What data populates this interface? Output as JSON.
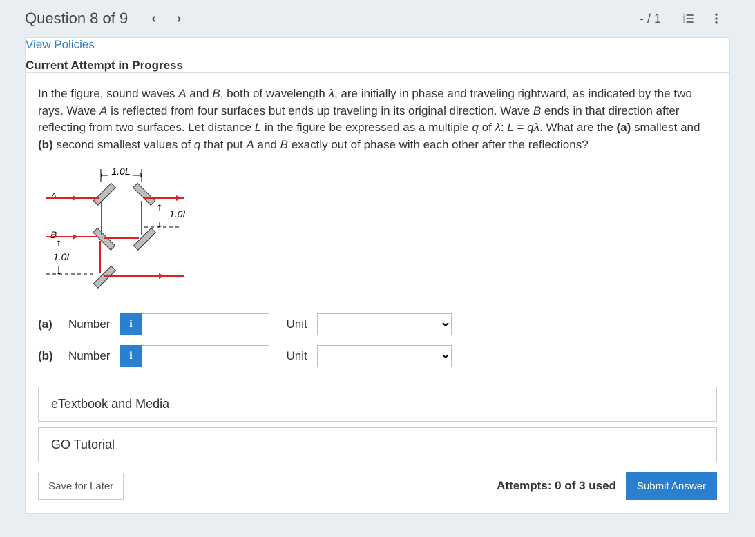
{
  "header": {
    "title": "Question 8 of 9",
    "score": "- / 1"
  },
  "links": {
    "policies": "View Policies"
  },
  "status": {
    "current": "Current Attempt in Progress"
  },
  "problem": {
    "text_html": "In the figure, sound waves <i>A</i> and <i>B</i>, both of wavelength <i>λ</i>, are initially in phase and traveling rightward, as indicated by the two rays. Wave <i>A</i> is reflected from four surfaces but ends up traveling in its original direction. Wave <i>B</i> ends in that direction after reflecting from two surfaces. Let distance <i>L</i> in the figure be expressed as a multiple <i>q</i> of <i>λ</i>: <i>L</i> = <i>qλ</i>. What are the <b>(a)</b> smallest and <b>(b)</b> second smallest values of <i>q</i> that put <i>A</i> and <i>B</i> exactly out of phase with each other after the reflections?"
  },
  "figure": {
    "dim_top": "1.0L",
    "dim_right": "1.0L",
    "dim_left": "1.0L",
    "label_a": "A",
    "label_b": "B"
  },
  "answers": {
    "a": {
      "part": "(a)",
      "number_label": "Number",
      "unit_label": "Unit",
      "info_symbol": "i"
    },
    "b": {
      "part": "(b)",
      "number_label": "Number",
      "unit_label": "Unit",
      "info_symbol": "i"
    }
  },
  "resources": {
    "etextbook": "eTextbook and Media",
    "go_tutorial": "GO Tutorial"
  },
  "footer": {
    "save": "Save for Later",
    "attempts": "Attempts: 0 of 3 used",
    "submit": "Submit Answer"
  }
}
